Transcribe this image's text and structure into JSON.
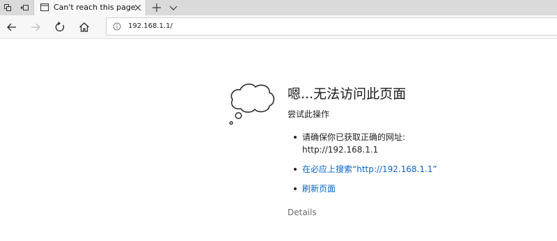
{
  "tab": {
    "title": "Can't reach this page",
    "icons": [
      "set-tabs-aside-icon",
      "restore-tabs-icon",
      "page-icon",
      "close-icon",
      "new-tab-icon",
      "tab-preview-chevron-icon"
    ]
  },
  "toolbar": {
    "icons": [
      "back-arrow-icon",
      "forward-arrow-icon",
      "refresh-icon",
      "home-icon",
      "info-icon"
    ],
    "address": "192.168.1.1/"
  },
  "error": {
    "title": "嗯...无法访问此页面",
    "subtitle": "尝试此操作",
    "suggestions": {
      "check_address_line1": "请确保你已获取正确的网址:",
      "check_address_line2": "http://192.168.1.1",
      "search_link": "在必应上搜索“http://192.168.1.1”",
      "refresh_link": "刷新页面"
    },
    "details": "Details"
  },
  "colors": {
    "tabstrip": "#dadada",
    "toolbar": "#f7f7f7",
    "link": "#0a63c7",
    "details": "#6a6a6a"
  }
}
